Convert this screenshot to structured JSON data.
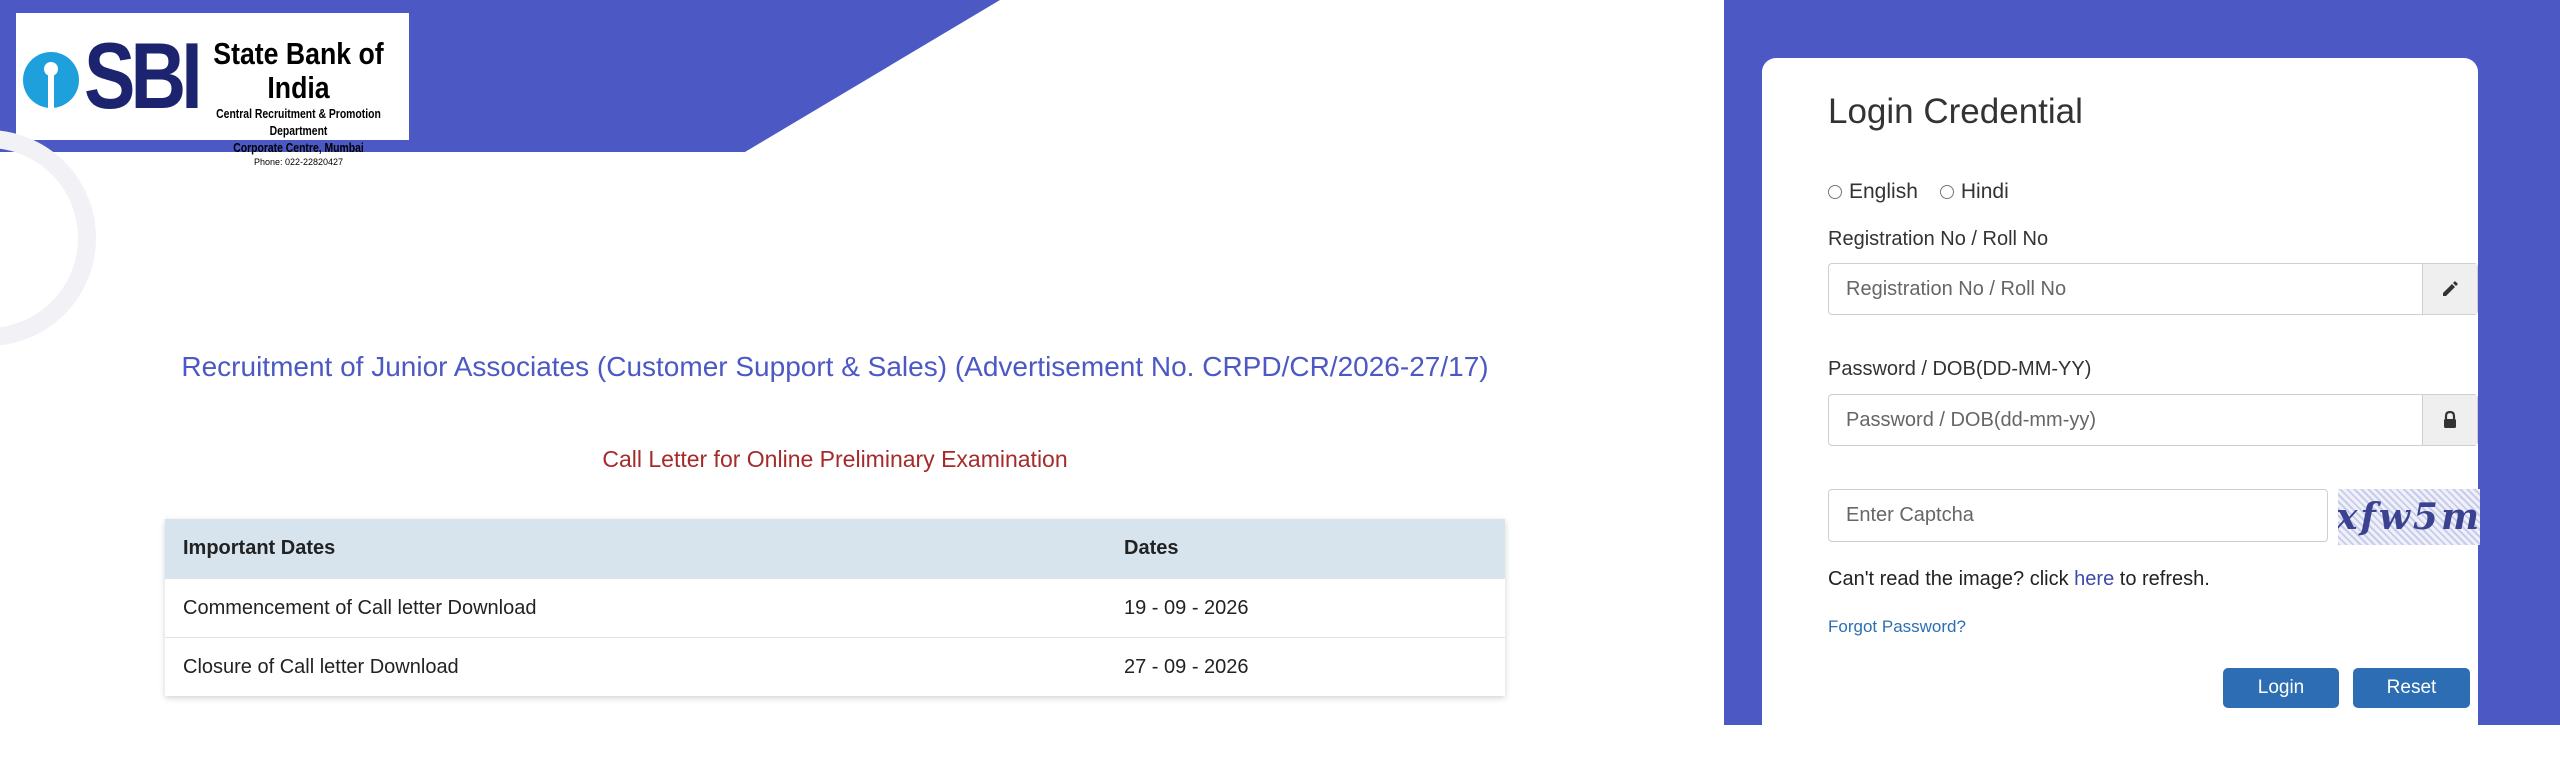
{
  "header": {
    "logo_sbi": "SBI",
    "logo_bank_name": "State Bank of India",
    "logo_department": "Central Recruitment & Promotion Department",
    "logo_location": "Corporate Centre, Mumbai",
    "logo_phone": "Phone: 022-22820427"
  },
  "main": {
    "title": "Recruitment of Junior Associates (Customer Support & Sales) (Advertisement No. CRPD/CR/2026-27/17)",
    "subtitle": "Call Letter for Online Preliminary Examination",
    "table": {
      "headers": [
        "Important Dates",
        "Dates"
      ],
      "rows": [
        [
          "Commencement of Call letter Download",
          "19 - 09 - 2026"
        ],
        [
          "Closure of Call letter Download",
          "27 - 09 - 2026"
        ]
      ]
    }
  },
  "login": {
    "title": "Login Credential",
    "language_options": [
      "English",
      "Hindi"
    ],
    "registration_label": "Registration No / Roll No",
    "registration_placeholder": "Registration No / Roll No",
    "password_label": "Password / DOB(DD-MM-YY)",
    "password_placeholder": "Password / DOB(dd-mm-yy)",
    "captcha_placeholder": "Enter Captcha",
    "captcha_text": "xfw5m",
    "refresh_prefix": "Can't read the image? click ",
    "refresh_link": "here",
    "refresh_suffix": " to refresh.",
    "forgot_password": "Forgot Password?",
    "login_button": "Login",
    "reset_button": "Reset"
  },
  "colors": {
    "brand": "#4c58c4",
    "subtitle_red": "#a62a2a",
    "table_header": "#d7e4ee",
    "button_blue": "#2d6db4"
  },
  "icons": {
    "registration_addon": "pencil-icon",
    "password_addon": "lock-icon"
  }
}
